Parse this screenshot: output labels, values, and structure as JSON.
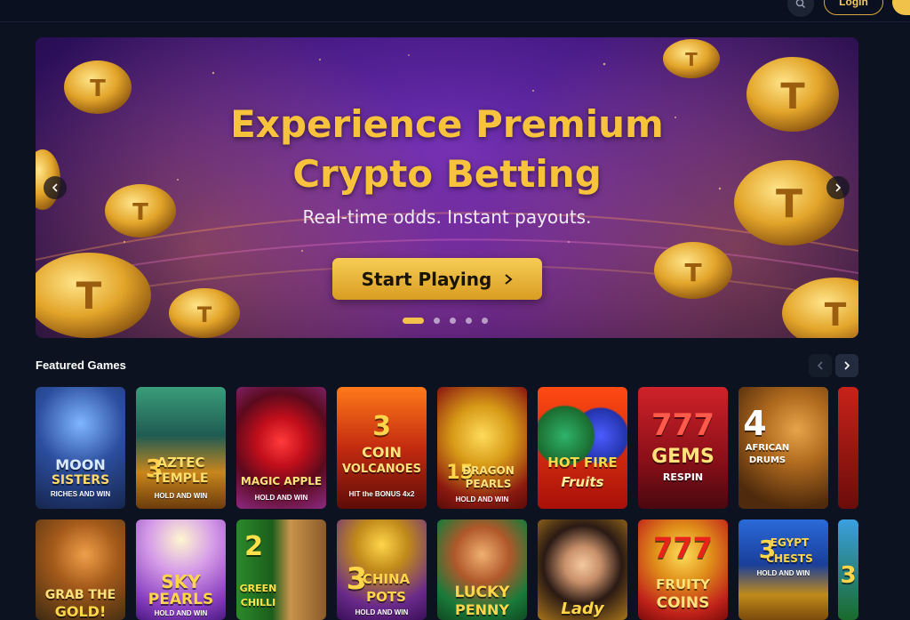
{
  "header": {
    "login_label": "Login",
    "search_icon": "search-icon"
  },
  "hero": {
    "title_line1": "Experience Premium",
    "title_line2": "Crypto Betting",
    "subtitle": "Real-time odds. Instant payouts.",
    "cta_label": "Start Playing",
    "slides_total": 5,
    "active_slide": 1,
    "accent": "#f8c33c"
  },
  "featured": {
    "title": "Featured Games",
    "row1": [
      {
        "title": "MOON",
        "line2": "SISTERS",
        "sub": "RICHES AND WIN"
      },
      {
        "num": "3",
        "title": "AZTEC",
        "line2": "TEMPLE",
        "sub": "HOLD AND WIN"
      },
      {
        "title": "MAGIC APPLE",
        "sub": "HOLD AND WIN"
      },
      {
        "num": "3",
        "title": "COIN",
        "line2": "VOLCANOES",
        "sub": "HIT the BONUS 4x2"
      },
      {
        "num": "15",
        "title": "DRAGON",
        "line2": "PEARLS",
        "sub": "HOLD AND WIN"
      },
      {
        "title": "HOT FIRE",
        "line2": "Fruits"
      },
      {
        "num": "777",
        "title": "GEMS",
        "line2": "RESPIN"
      },
      {
        "num": "4",
        "title": "AFRICAN",
        "line2": "DRUMS"
      },
      {
        "title": ""
      }
    ],
    "row2": [
      {
        "title": "GRAB THE",
        "line2": "GOLD!"
      },
      {
        "title": "SKY",
        "line2": "PEARLS",
        "sub": "HOLD AND WIN"
      },
      {
        "num": "2",
        "title": "GREEN",
        "line2": "CHILLI"
      },
      {
        "num": "3",
        "title": "CHINA",
        "line2": "POTS",
        "sub": "HOLD AND WIN"
      },
      {
        "title": "LUCKY",
        "line2": "PENNY"
      },
      {
        "title": "Lady"
      },
      {
        "num": "777",
        "title": "FRUITY",
        "line2": "COINS"
      },
      {
        "num": "3",
        "title": "EGYPT",
        "line2": "CHESTS",
        "sub": "HOLD AND WIN"
      },
      {
        "num": "3"
      }
    ]
  }
}
